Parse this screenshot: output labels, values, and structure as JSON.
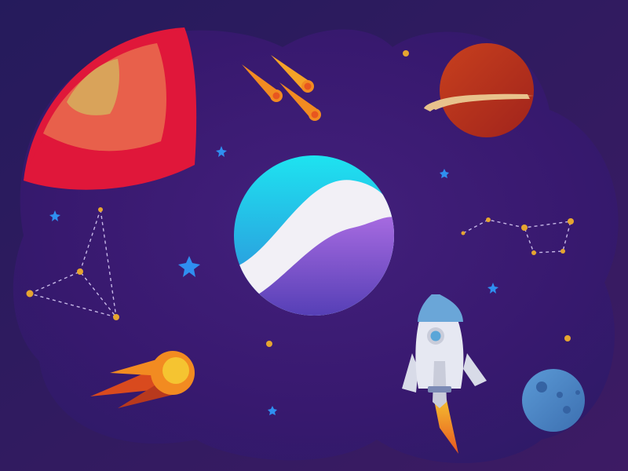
{
  "scene": {
    "elements": [
      "cloud-shaped-space-window",
      "red-planet-with-rings",
      "saturn-planet-with-ring",
      "wave-planet",
      "three-falling-comets",
      "large-comet",
      "rocket-with-flame",
      "cratered-moon",
      "constellation-left",
      "constellation-right",
      "stars"
    ]
  },
  "palette": {
    "background_outer_left": "#251b5c",
    "background_outer_right": "#3d1b64",
    "window_inner": "#3a1d74",
    "red_planet_outer": "#e01a3a",
    "red_planet_middle": "#e8604b",
    "red_planet_inner": "#d9a35a",
    "saturn_body": "#b2321c",
    "saturn_ring": "#e8c28c",
    "wave_planet_top": "#21d0ea",
    "wave_planet_bottom": "#5b3bb8",
    "wave_planet_wave": "#f2f0f6",
    "comet_orange": "#f28b21",
    "comet_yellow": "#f5c431",
    "star_blue": "#2f8ff0",
    "dot_gold": "#e6a530",
    "rocket_body": "#e6e8f2",
    "rocket_window": "#5aa6d8",
    "moon": "#4f8ac7",
    "constellation_line": "#c6b8e6"
  }
}
